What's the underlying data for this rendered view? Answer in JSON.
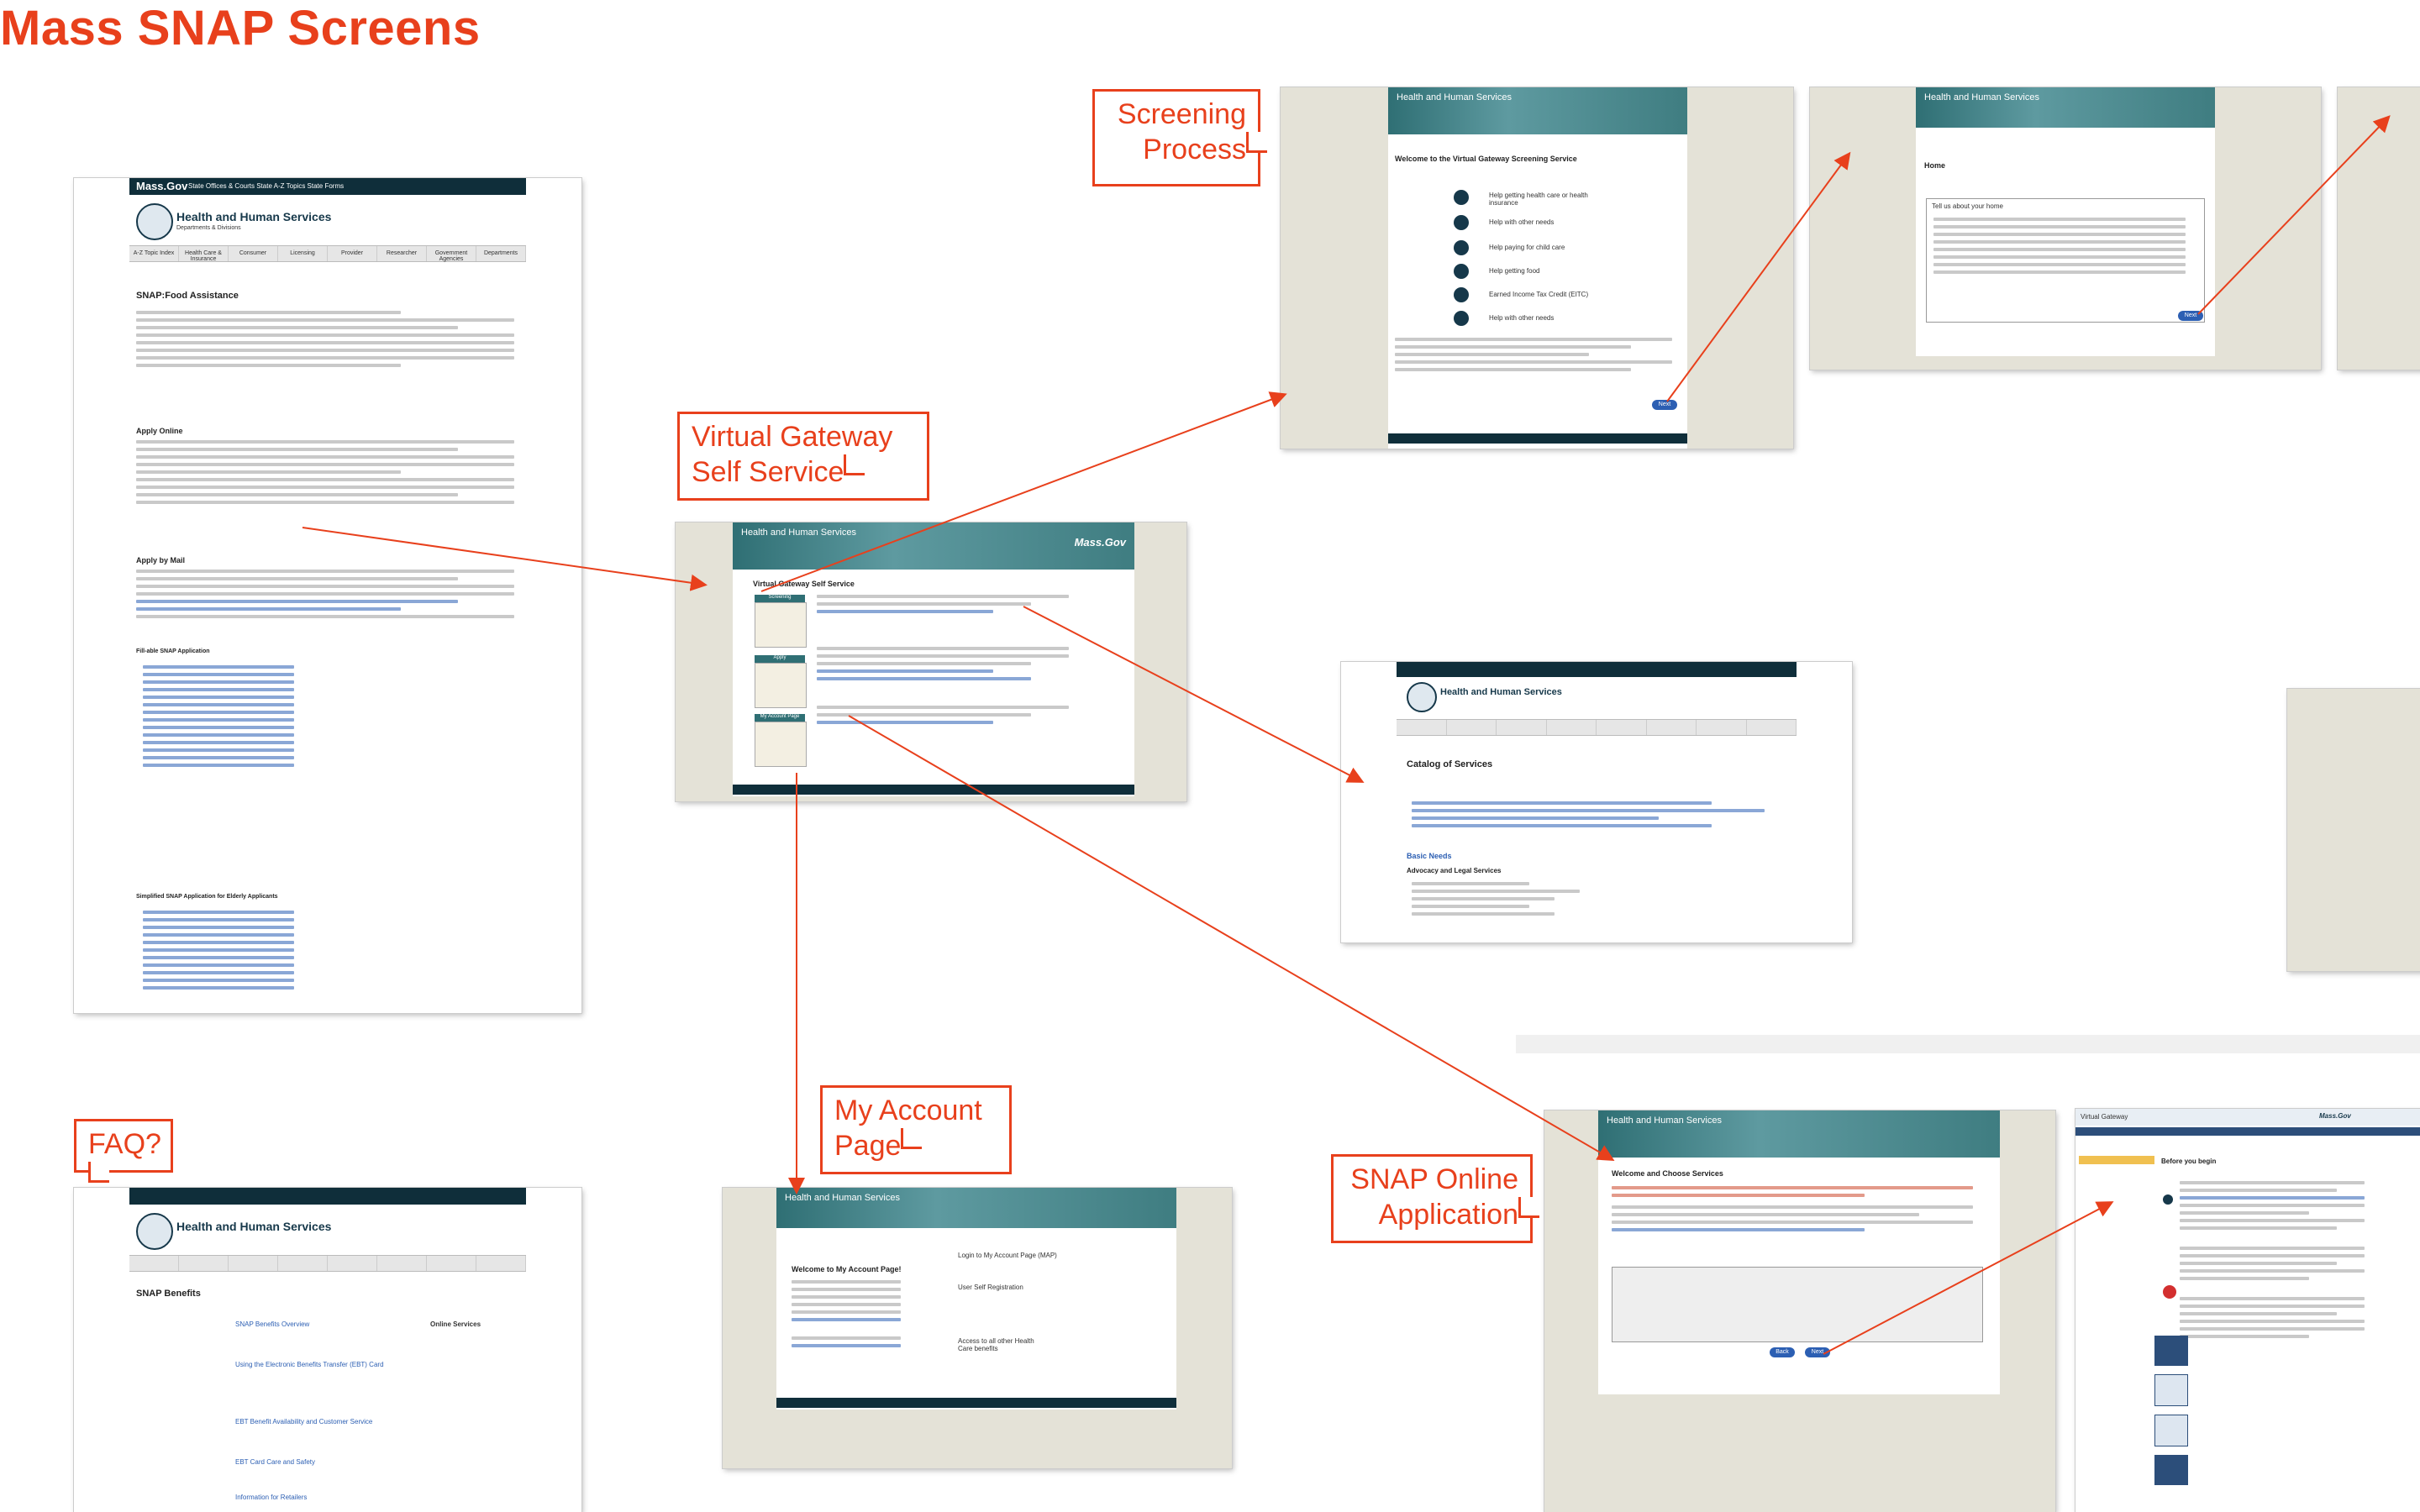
{
  "title": "Mass SNAP Screens",
  "callouts": {
    "screening": "Screening\nProcess",
    "vg": "Virtual Gateway\nSelf Service",
    "account": "My Account\nPage",
    "faq": "FAQ?",
    "snap": "SNAP Online\nApplication"
  },
  "colors": {
    "accent": "#e8401c",
    "navy": "#0f2e3a",
    "teal": "#2f6f74"
  },
  "mass_page": {
    "logo": "Mass.Gov",
    "top_links": "State Offices & Courts   State A-Z Topics   State Forms",
    "heading": "Health and Human Services",
    "sub": "Departments & Divisions",
    "tabs": [
      "A-Z Topic Index",
      "Health Care & Insurance",
      "Consumer",
      "Licensing",
      "Provider",
      "Researcher",
      "Government Agencies",
      "Departments"
    ],
    "page_title": "SNAP:Food Assistance",
    "section1": "Apply Online",
    "section2": "Apply by Mail",
    "section3": "Fill-able SNAP Application",
    "section4": "Simplified SNAP Application for Elderly Applicants"
  },
  "vg_page": {
    "banner": "Health and Human Services",
    "logo": "Mass.Gov",
    "title": "Virtual Gateway Self Service",
    "boxes": [
      "Screening",
      "Apply",
      "My Account Page"
    ]
  },
  "screening_page": {
    "banner": "Health and Human Services",
    "title": "Welcome to the Virtual Gateway Screening Service",
    "items": [
      "Help getting health care or health insurance",
      "Help with other needs",
      "Help paying for child care",
      "Help getting food",
      "Earned Income Tax Credit (EITC)",
      "Help with other needs"
    ],
    "next": "Next"
  },
  "screening2_page": {
    "banner": "Health and Human Services",
    "title": "Home",
    "box": "Tell us about your home"
  },
  "catalog_page": {
    "heading": "Health and Human Services",
    "page_title": "Catalog of Services",
    "section": "Basic Needs",
    "subsection": "Advocacy and Legal Services"
  },
  "account_page": {
    "banner": "Health and Human Services",
    "title": "Welcome to My Account Page!",
    "links": [
      "Login to My Account Page (MAP)",
      "User Self Registration",
      "Access to all other Health Care benefits"
    ]
  },
  "faq_page": {
    "heading": "Health and Human Services",
    "page_title": "SNAP Benefits",
    "items": [
      "SNAP Benefits Overview",
      "Using the Electronic Benefits Transfer (EBT) Card",
      "EBT Benefit Availability and Customer Service",
      "EBT Card Care and Safety",
      "Information for Retailers"
    ],
    "side": "Online Services"
  },
  "snap_app_page": {
    "banner": "Health and Human Services",
    "title": "Welcome and Choose Services"
  },
  "vg_before_page": {
    "header": "Virtual Gateway",
    "logo": "Mass.Gov",
    "title": "Before you begin"
  }
}
